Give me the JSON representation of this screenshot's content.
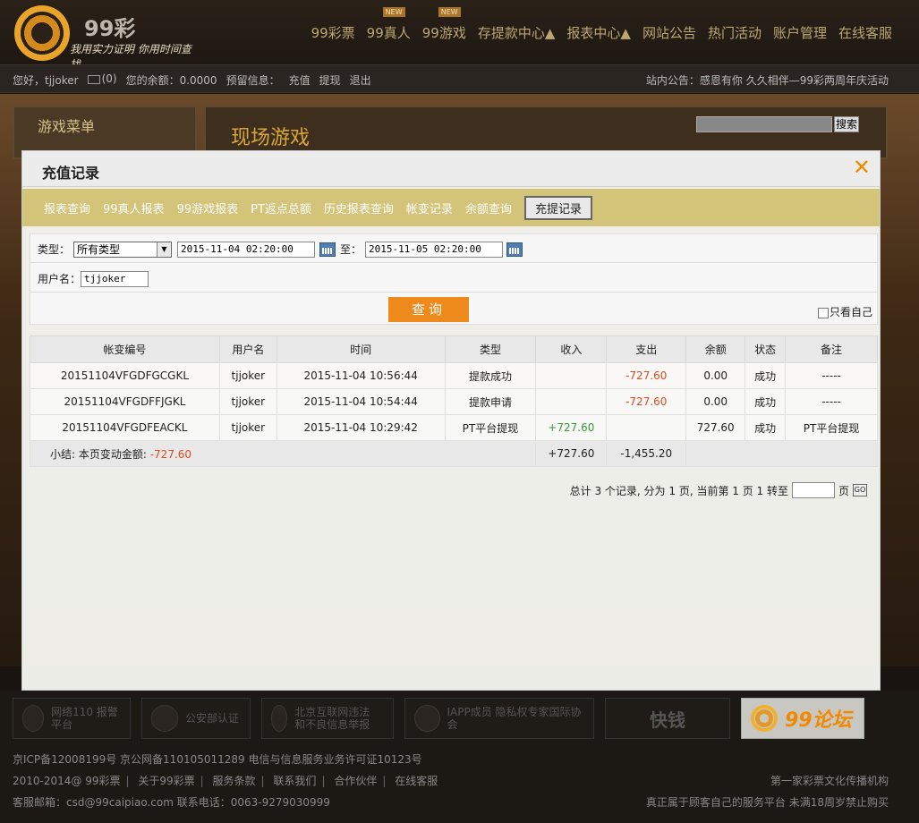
{
  "logo": {
    "brand": "99彩",
    "slogan": "我用实力证明 你用时间查找"
  },
  "nav": [
    {
      "label": "99彩票",
      "badge": ""
    },
    {
      "label": "99真人",
      "badge": "NEW"
    },
    {
      "label": "99游戏",
      "badge": "NEW"
    },
    {
      "label": "存提款中心▲",
      "badge": ""
    },
    {
      "label": "报表中心▲",
      "badge": ""
    },
    {
      "label": "网站公告",
      "badge": ""
    },
    {
      "label": "热门活动",
      "badge": ""
    },
    {
      "label": "账户管理",
      "badge": ""
    },
    {
      "label": "在线客服",
      "badge": ""
    }
  ],
  "userbar": {
    "greeting": "您好，tjjoker",
    "mail_count": "(0)",
    "balance": "您的余额：0.0000",
    "reserve": "预留信息：",
    "recharge": "充值",
    "withdraw": "提现",
    "logout": "退出",
    "notice": "站内公告：感恩有你 久久相伴—99彩两周年庆活动"
  },
  "sidebar": {
    "title": "游戏菜单"
  },
  "content": {
    "title": "现场游戏",
    "search_button": "搜索"
  },
  "modal": {
    "title": "充值记录",
    "close": "✕",
    "tabs": [
      "报表查询",
      "99真人报表",
      "99游戏报表",
      "PT返点总额",
      "历史报表查询",
      "帐变记录",
      "余额查询",
      "充提记录"
    ],
    "active_tab": 7
  },
  "filter": {
    "type_label": "类型：",
    "type_value": "所有类型",
    "start": "2015-11-04 02:20:00",
    "to_label": "至：",
    "end": "2015-11-05 02:20:00",
    "username_label": "用户名：",
    "username_value": "tjjoker",
    "query_button": "查询",
    "only_self": "只看自己"
  },
  "table": {
    "headers": [
      "帐变编号",
      "用户名",
      "时间",
      "类型",
      "收入",
      "支出",
      "余额",
      "状态",
      "备注"
    ],
    "rows": [
      [
        "20151104VFGDFGCGKL",
        "tjjoker",
        "2015-11-04 10:56:44",
        "提款成功",
        "",
        "-727.60",
        "0.00",
        "成功",
        "-----"
      ],
      [
        "20151104VFGDFFJGKL",
        "tjjoker",
        "2015-11-04 10:54:44",
        "提款申请",
        "",
        "-727.60",
        "0.00",
        "成功",
        "-----"
      ],
      [
        "20151104VFGDFEACKL",
        "tjjoker",
        "2015-11-04 10:29:42",
        "PT平台提现",
        "+727.60",
        "",
        "727.60",
        "成功",
        "PT平台提现"
      ]
    ],
    "summary": {
      "label": "小结: 本页变动金额: ",
      "amount": "-727.60",
      "income": "+727.60",
      "expense": "-1,455.20"
    }
  },
  "pager": {
    "text": "总计 3 个记录, 分为 1 页, 当前第 1 页 1 转至",
    "page_suffix": "页",
    "go": "GO"
  },
  "footer": {
    "badges": [
      {
        "label": "网络110 报警平台"
      },
      {
        "label": "公安部认证"
      },
      {
        "label": "北京互联网违法 和不良信息举报"
      },
      {
        "label": "IAPP成员 隐私权专家国际协会"
      },
      {
        "label": "快钱"
      },
      {
        "label": "99论坛"
      }
    ],
    "icp": "京ICP备12008199号 京公网备110105011289 电信与信息服务业务许可证10123号",
    "copyright": [
      "2010-2014@ 99彩票",
      "关于99彩票",
      "服务条款",
      "联系我们",
      "合作伙伴",
      "在线客服"
    ],
    "contact": "客服邮箱：csd@99caipiao.com 联系电话：0063-9279030999",
    "right1": "第一家彩票文化传播机构",
    "right2": "真正属于顾客自己的服务平台 未满18周岁禁止购买"
  }
}
